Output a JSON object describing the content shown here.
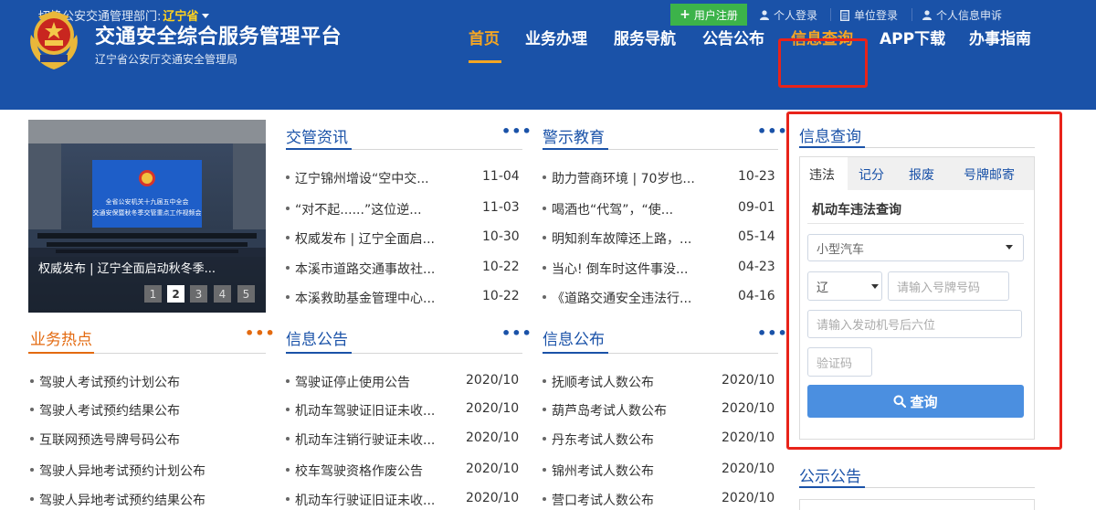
{
  "topbar": {
    "switch_label": "切换公安交通管理部门:",
    "province": "辽宁省",
    "register": "用户注册",
    "personal_login": "个人登录",
    "unit_login": "单位登录",
    "personal_info": "个人信息申诉"
  },
  "header": {
    "title": "交通安全综合服务管理平台",
    "subtitle": "辽宁省公安厅交通安全管理局"
  },
  "nav": [
    "首页",
    "业务办理",
    "服务导航",
    "公告公布",
    "信息查询",
    "APP下载",
    "办事指南"
  ],
  "slide": {
    "caption": "权威发布 | 辽宁全面启动秋冬季...",
    "pages": [
      "1",
      "2",
      "3",
      "4",
      "5"
    ],
    "active_page": "2",
    "banner_line1": "全省公安机关十九届五中全会",
    "banner_line2": "交通安保暨秋冬季交管重点工作视频会"
  },
  "sections": {
    "news": {
      "title": "交管资讯",
      "items": [
        {
          "text": "辽宁锦州增设“空中交...",
          "date": "11-04"
        },
        {
          "text": "“对不起......”这位逆...",
          "date": "11-03"
        },
        {
          "text": "权威发布 | 辽宁全面启...",
          "date": "10-30"
        },
        {
          "text": "本溪市道路交通事故社...",
          "date": "10-22"
        },
        {
          "text": "本溪救助基金管理中心...",
          "date": "10-22"
        }
      ]
    },
    "warning": {
      "title": "警示教育",
      "items": [
        {
          "text": "助力营商环境 | 70岁也...",
          "date": "10-23"
        },
        {
          "text": "喝酒也“代驾”，“使...",
          "date": "09-01"
        },
        {
          "text": "明知刹车故障还上路，...",
          "date": "05-14"
        },
        {
          "text": "当心! 倒车时这件事没...",
          "date": "04-23"
        },
        {
          "text": "《道路交通安全违法行...",
          "date": "04-16"
        }
      ]
    },
    "hot": {
      "title": "业务热点",
      "items": [
        "驾驶人考试预约计划公布",
        "驾驶人考试预约结果公布",
        "互联网预选号牌号码公布",
        "驾驶人异地考试预约计划公布",
        "驾驶人异地考试预约结果公布"
      ]
    },
    "info": {
      "title": "信息公告",
      "items": [
        {
          "text": "驾驶证停止使用公告",
          "date": "2020/10"
        },
        {
          "text": "机动车驾驶证旧证未收...",
          "date": "2020/10"
        },
        {
          "text": "机动车注销行驶证未收...",
          "date": "2020/10"
        },
        {
          "text": "校车驾驶资格作废公告",
          "date": "2020/10"
        },
        {
          "text": "机动车行驶证旧证未收...",
          "date": "2020/10"
        }
      ]
    },
    "publish": {
      "title": "信息公布",
      "items": [
        {
          "text": "抚顺考试人数公布",
          "date": "2020/10"
        },
        {
          "text": "葫芦岛考试人数公布",
          "date": "2020/10"
        },
        {
          "text": "丹东考试人数公布",
          "date": "2020/10"
        },
        {
          "text": "锦州考试人数公布",
          "date": "2020/10"
        },
        {
          "text": "营口考试人数公布",
          "date": "2020/10"
        }
      ]
    }
  },
  "query_panel": {
    "title": "信息查询",
    "tabs": [
      "违法",
      "记分",
      "报废",
      "号牌邮寄"
    ],
    "active_tab": "违法",
    "subtitle": "机动车违法查询",
    "vehicle_type": "小型汽车",
    "province_prefix": "辽",
    "plate_placeholder": "请输入号牌号码",
    "engine_placeholder": "请输入发动机号后六位",
    "captcha_placeholder": "验证码",
    "button": "查询"
  },
  "notice": {
    "title": "公示公告"
  },
  "colors": {
    "brand_blue": "#1a52a8",
    "accent_orange": "#f5a623",
    "hot_orange": "#e36a10",
    "highlight_red": "#e8231a",
    "register_green": "#3cb34a",
    "button_blue": "#4b8fe0"
  }
}
